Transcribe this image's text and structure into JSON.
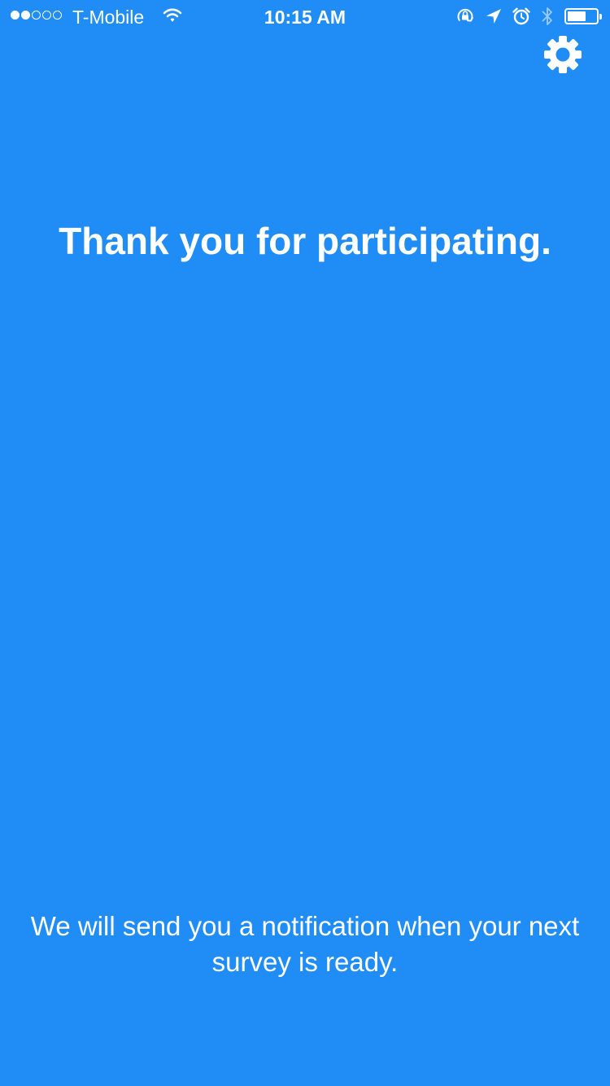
{
  "theme": {
    "background_color": "#208cf5",
    "text_color": "#ffffff"
  },
  "status_bar": {
    "signal": {
      "filled_bars": 2,
      "total_bars": 5
    },
    "carrier": "T-Mobile",
    "time": "10:15 AM",
    "battery_level": 0.65,
    "icons": [
      "wifi-icon",
      "orientation-lock-icon",
      "location-arrow-icon",
      "alarm-clock-icon",
      "bluetooth-icon",
      "battery-icon"
    ]
  },
  "header": {
    "settings_icon": "gear-icon"
  },
  "main": {
    "headline": "Thank you for participating.",
    "footer_message": "We will send you a notification when your next survey is ready."
  }
}
